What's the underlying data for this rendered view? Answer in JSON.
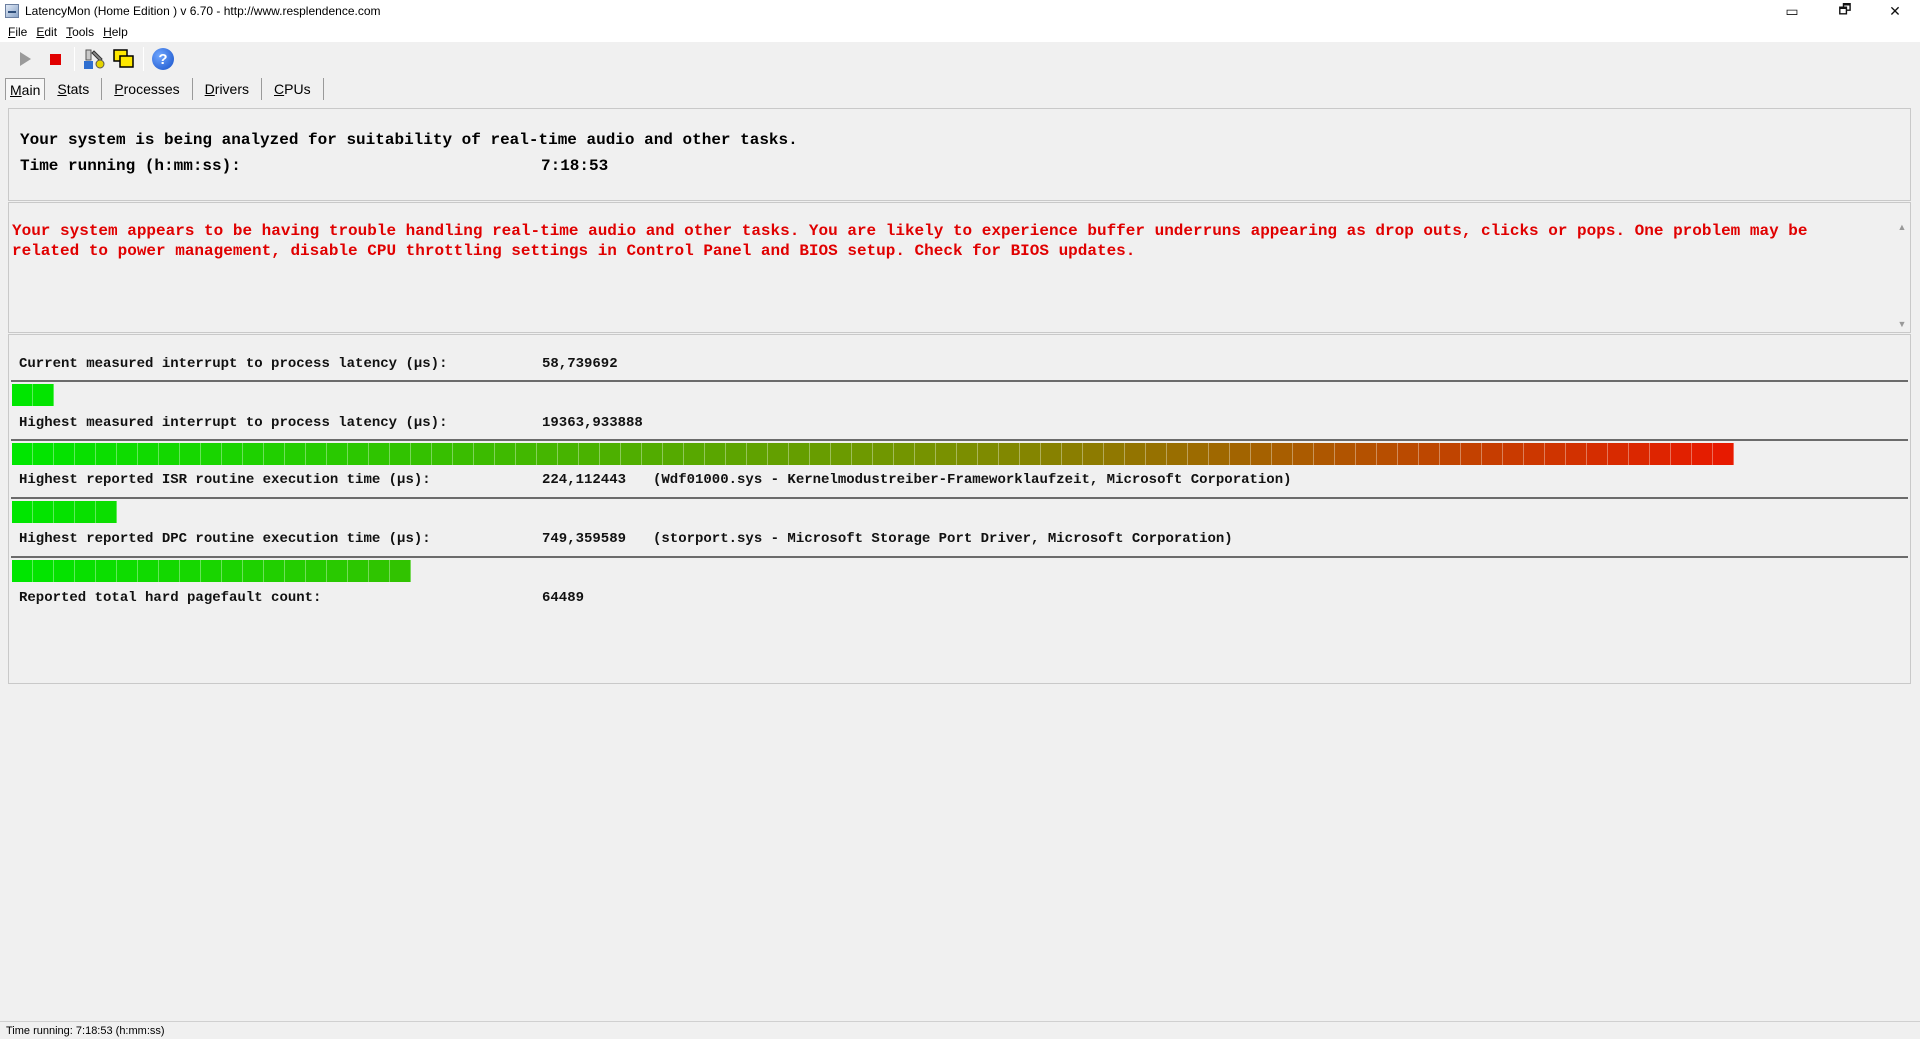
{
  "window": {
    "title": "LatencyMon  (Home Edition )  v 6.70 - http://www.resplendence.com",
    "maximize_glyph": "▭",
    "restore_glyph": "🗗",
    "close_glyph": "✕"
  },
  "menu": [
    {
      "key": "F",
      "rest": "ile"
    },
    {
      "key": "E",
      "rest": "dit"
    },
    {
      "key": "T",
      "rest": "ools"
    },
    {
      "key": "H",
      "rest": "elp"
    }
  ],
  "tabs": [
    {
      "key": "M",
      "rest": "ain",
      "active": true
    },
    {
      "key": "S",
      "rest": "tats",
      "active": false
    },
    {
      "key": "P",
      "rest": "rocesses",
      "active": false
    },
    {
      "key": "D",
      "rest": "rivers",
      "active": false
    },
    {
      "key": "C",
      "rest": "PUs",
      "active": false
    }
  ],
  "summary": {
    "line1": "Your system is being analyzed for suitability of real-time audio and other tasks.",
    "time_label": "Time running (h:mm:ss):",
    "time_value": "7:18:53"
  },
  "warning": {
    "line1": "Your system appears to be having trouble handling real-time audio and other tasks. You are likely to experience buffer underruns appearing as drop outs, clicks or pops. One problem may be",
    "line2": "related to power management, disable CPU throttling settings in Control Panel and BIOS setup. Check for BIOS updates."
  },
  "metrics": {
    "current_latency": {
      "label": "Current measured interrupt to process latency (µs):",
      "value": "58,739692",
      "bar_segments": 2
    },
    "highest_latency": {
      "label": "Highest measured interrupt to process latency (µs):",
      "value": "19363,933888",
      "bar_segments": 82
    },
    "highest_isr": {
      "label": "Highest reported ISR routine execution time (µs):",
      "value": "224,112443",
      "note": "(Wdf01000.sys - Kernelmodustreiber-Frameworklaufzeit, Microsoft Corporation)",
      "bar_segments": 5
    },
    "highest_dpc": {
      "label": "Highest reported DPC routine execution time (µs):",
      "value": "749,359589",
      "note": "(storport.sys - Microsoft Storage Port Driver, Microsoft Corporation)",
      "bar_segments": 19
    },
    "pagefault": {
      "label": "Reported total hard pagefault count:",
      "value": "64489"
    }
  },
  "bar_colors": {
    "start": "#00e600",
    "mid": "#7a9000",
    "end": "#ff0000"
  },
  "status": {
    "text": "Time running: 7:18:53  (h:mm:ss)"
  }
}
